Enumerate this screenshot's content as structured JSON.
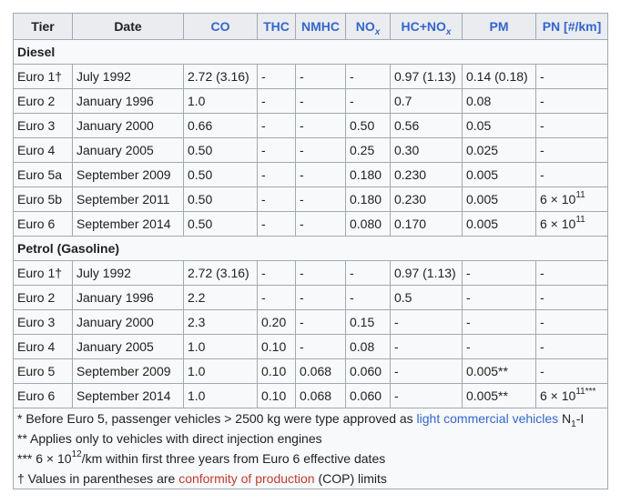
{
  "table": {
    "headers": {
      "tier": "Tier",
      "date": "Date",
      "co": "CO",
      "thc": "THC",
      "nmhc": "NMHC",
      "nox_main": "NO",
      "nox_sub": "x",
      "hcnox_main": "HC+NO",
      "hcnox_sub": "x",
      "pm": "PM",
      "pn": "PN [#/km]"
    },
    "sections": {
      "diesel": "Diesel",
      "petrol": "Petrol (Gasoline)"
    },
    "diesel_rows": [
      {
        "tier": "Euro 1†",
        "date": "July 1992",
        "co": "2.72 (3.16)",
        "thc": "-",
        "nmhc": "-",
        "nox": "-",
        "hcnox": "0.97 (1.13)",
        "pm": "0.14 (0.18)",
        "pn": "-"
      },
      {
        "tier": "Euro 2",
        "date": "January 1996",
        "co": "1.0",
        "thc": "-",
        "nmhc": "-",
        "nox": "-",
        "hcnox": "0.7",
        "pm": "0.08",
        "pn": "-"
      },
      {
        "tier": "Euro 3",
        "date": "January 2000",
        "co": "0.66",
        "thc": "-",
        "nmhc": "-",
        "nox": "0.50",
        "hcnox": "0.56",
        "pm": "0.05",
        "pn": "-"
      },
      {
        "tier": "Euro 4",
        "date": "January 2005",
        "co": "0.50",
        "thc": "-",
        "nmhc": "-",
        "nox": "0.25",
        "hcnox": "0.30",
        "pm": "0.025",
        "pn": "-"
      },
      {
        "tier": "Euro 5a",
        "date": "September 2009",
        "co": "0.50",
        "thc": "-",
        "nmhc": "-",
        "nox": "0.180",
        "hcnox": "0.230",
        "pm": "0.005",
        "pn": "-"
      },
      {
        "tier": "Euro 5b",
        "date": "September 2011",
        "co": "0.50",
        "thc": "-",
        "nmhc": "-",
        "nox": "0.180",
        "hcnox": "0.230",
        "pm": "0.005",
        "pn": "6 × 10",
        "pn_exp": "11"
      },
      {
        "tier": "Euro 6",
        "date": "September 2014",
        "co": "0.50",
        "thc": "-",
        "nmhc": "-",
        "nox": "0.080",
        "hcnox": "0.170",
        "pm": "0.005",
        "pn": "6 × 10",
        "pn_exp": "11"
      }
    ],
    "petrol_rows": [
      {
        "tier": "Euro 1†",
        "date": "July 1992",
        "co": "2.72 (3.16)",
        "thc": "-",
        "nmhc": "-",
        "nox": "-",
        "hcnox": "0.97 (1.13)",
        "pm": "-",
        "pn": "-"
      },
      {
        "tier": "Euro 2",
        "date": "January 1996",
        "co": "2.2",
        "thc": "-",
        "nmhc": "-",
        "nox": "-",
        "hcnox": "0.5",
        "pm": "-",
        "pn": "-"
      },
      {
        "tier": "Euro 3",
        "date": "January 2000",
        "co": "2.3",
        "thc": "0.20",
        "nmhc": "-",
        "nox": "0.15",
        "hcnox": "-",
        "pm": "-",
        "pn": "-"
      },
      {
        "tier": "Euro 4",
        "date": "January 2005",
        "co": "1.0",
        "thc": "0.10",
        "nmhc": "-",
        "nox": "0.08",
        "hcnox": "-",
        "pm": "-",
        "pn": "-"
      },
      {
        "tier": "Euro 5",
        "date": "September 2009",
        "co": "1.0",
        "thc": "0.10",
        "nmhc": "0.068",
        "nox": "0.060",
        "hcnox": "-",
        "pm": "0.005**",
        "pn": "-"
      },
      {
        "tier": "Euro 6",
        "date": "September 2014",
        "co": "1.0",
        "thc": "0.10",
        "nmhc": "0.068",
        "nox": "0.060",
        "hcnox": "-",
        "pm": "0.005**",
        "pn": "6 × 10",
        "pn_exp": "11",
        "pn_suffix": "***"
      }
    ],
    "footnotes": {
      "f1_pre": "* Before Euro 5, passenger vehicles > 2500 kg were type approved as ",
      "f1_link": "light commercial vehicles",
      "f1_mid": " N",
      "f1_sub": "1",
      "f1_post": "-I",
      "f2": "** Applies only to vehicles with direct injection engines",
      "f3_pre": "*** 6 × 10",
      "f3_exp": "12",
      "f3_post": "/km within first three years from Euro 6 effective dates",
      "f4_pre": "† Values in parentheses are ",
      "f4_link": "conformity of production",
      "f4_post": " (COP) limits"
    }
  }
}
